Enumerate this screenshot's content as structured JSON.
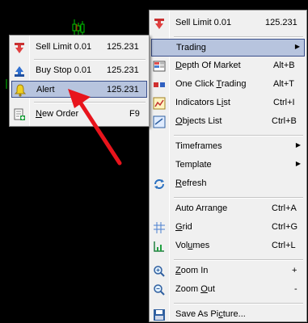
{
  "small_menu": {
    "items": [
      {
        "id": "sell-limit",
        "label": "Sell Limit 0.01",
        "shortcut": "125.231",
        "icon": "sell-limit-icon"
      },
      {
        "id": "buy-stop",
        "label": "Buy Stop 0.01",
        "shortcut": "125.231",
        "icon": "buy-stop-icon"
      },
      {
        "id": "alert",
        "label": "Alert",
        "shortcut": "125.231",
        "icon": "alert-bell-icon",
        "highlighted": true
      },
      {
        "id": "new-order",
        "label_pre": "",
        "label_u": "N",
        "label_post": "ew Order",
        "shortcut": "F9",
        "icon": "new-order-icon"
      }
    ]
  },
  "big_menu": {
    "items": [
      {
        "id": "sell-limit",
        "label": "Sell Limit 0.01",
        "shortcut": "125.231",
        "icon": "sell-limit-icon"
      },
      {
        "id": "trading",
        "label": "Trading",
        "has_submenu": true,
        "highlighted": true
      },
      {
        "id": "depth-of-market",
        "label_pre": "",
        "label_u": "D",
        "label_post": "epth Of Market",
        "shortcut": "Alt+B",
        "icon": "depth-of-market-icon"
      },
      {
        "id": "one-click-trading",
        "label_pre": "One Click ",
        "label_u": "T",
        "label_post": "rading",
        "shortcut": "Alt+T",
        "icon": "one-click-trading-icon"
      },
      {
        "id": "indicators-list",
        "label_pre": "Indicators L",
        "label_u": "i",
        "label_post": "st",
        "shortcut": "Ctrl+I",
        "icon": "indicators-list-icon"
      },
      {
        "id": "objects-list",
        "label_pre": "",
        "label_u": "O",
        "label_post": "bjects List",
        "shortcut": "Ctrl+B",
        "icon": "objects-list-icon"
      },
      {
        "id": "timeframes",
        "label": "Timeframes",
        "has_submenu": true
      },
      {
        "id": "template",
        "label": "Template",
        "has_submenu": true
      },
      {
        "id": "refresh",
        "label_pre": "",
        "label_u": "R",
        "label_post": "efresh",
        "icon": "refresh-icon"
      },
      {
        "id": "auto-arrange",
        "label": "Auto Arrange",
        "shortcut": "Ctrl+A"
      },
      {
        "id": "grid",
        "label_pre": "",
        "label_u": "G",
        "label_post": "rid",
        "shortcut": "Ctrl+G",
        "icon": "grid-icon"
      },
      {
        "id": "volumes",
        "label_pre": "Vol",
        "label_u": "u",
        "label_post": "mes",
        "shortcut": "Ctrl+L",
        "icon": "volumes-icon"
      },
      {
        "id": "zoom-in",
        "label_pre": "",
        "label_u": "Z",
        "label_post": "oom In",
        "shortcut": "+",
        "icon": "zoom-in-icon"
      },
      {
        "id": "zoom-out",
        "label_pre": "Zoom ",
        "label_u": "O",
        "label_post": "ut",
        "shortcut": "-",
        "icon": "zoom-out-icon"
      },
      {
        "id": "save-as-picture",
        "label_pre": "Save As Pi",
        "label_u": "c",
        "label_post": "ture...",
        "icon": "save-as-picture-icon"
      }
    ]
  },
  "colors": {
    "background": "#000000",
    "menu_bg": "#f0f0f0",
    "highlight_bg": "#b7c4de",
    "highlight_border": "#3a4f8a",
    "arrow": "#e8141c",
    "candle_up": "#00c800"
  }
}
